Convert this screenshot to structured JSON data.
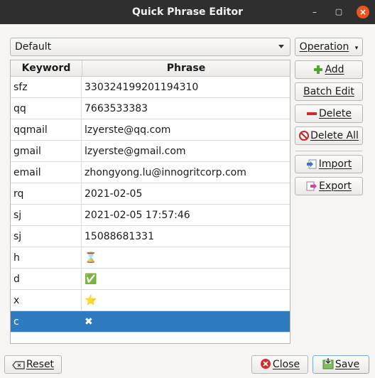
{
  "window": {
    "title": "Quick Phrase Editor"
  },
  "group_select": {
    "value": "Default"
  },
  "operation_button": {
    "label": "Operation"
  },
  "table": {
    "headers": {
      "keyword": "Keyword",
      "phrase": "Phrase"
    },
    "rows": [
      {
        "keyword": "sfz",
        "phrase": "330324199201194310"
      },
      {
        "keyword": "qq",
        "phrase": "7663533383"
      },
      {
        "keyword": "qqmail",
        "phrase": "lzyerste@qq.com"
      },
      {
        "keyword": "gmail",
        "phrase": "lzyerste@gmail.com"
      },
      {
        "keyword": "email",
        "phrase": "zhongyong.lu@innogritcorp.com"
      },
      {
        "keyword": "rq",
        "phrase": "2021-02-05"
      },
      {
        "keyword": "sj",
        "phrase": "2021-02-05 17:57:46"
      },
      {
        "keyword": "sj",
        "phrase": "15088681331"
      },
      {
        "keyword": "h",
        "phrase": "⌛"
      },
      {
        "keyword": "d",
        "phrase": "✅"
      },
      {
        "keyword": "x",
        "phrase": "⭐"
      },
      {
        "keyword": "c",
        "phrase": "✖"
      }
    ],
    "selected_row_index": 11
  },
  "side_buttons": {
    "add": "Add",
    "batch_edit": "Batch Edit",
    "delete": "Delete",
    "delete_all": "Delete All",
    "import": "Import",
    "export": "Export"
  },
  "bottom_buttons": {
    "reset": "Reset",
    "close": "Close",
    "save": "Save"
  },
  "colors": {
    "selection": "#2f7bbf",
    "titlebar": "#2f2f2f",
    "close_accent": "#e95420"
  }
}
